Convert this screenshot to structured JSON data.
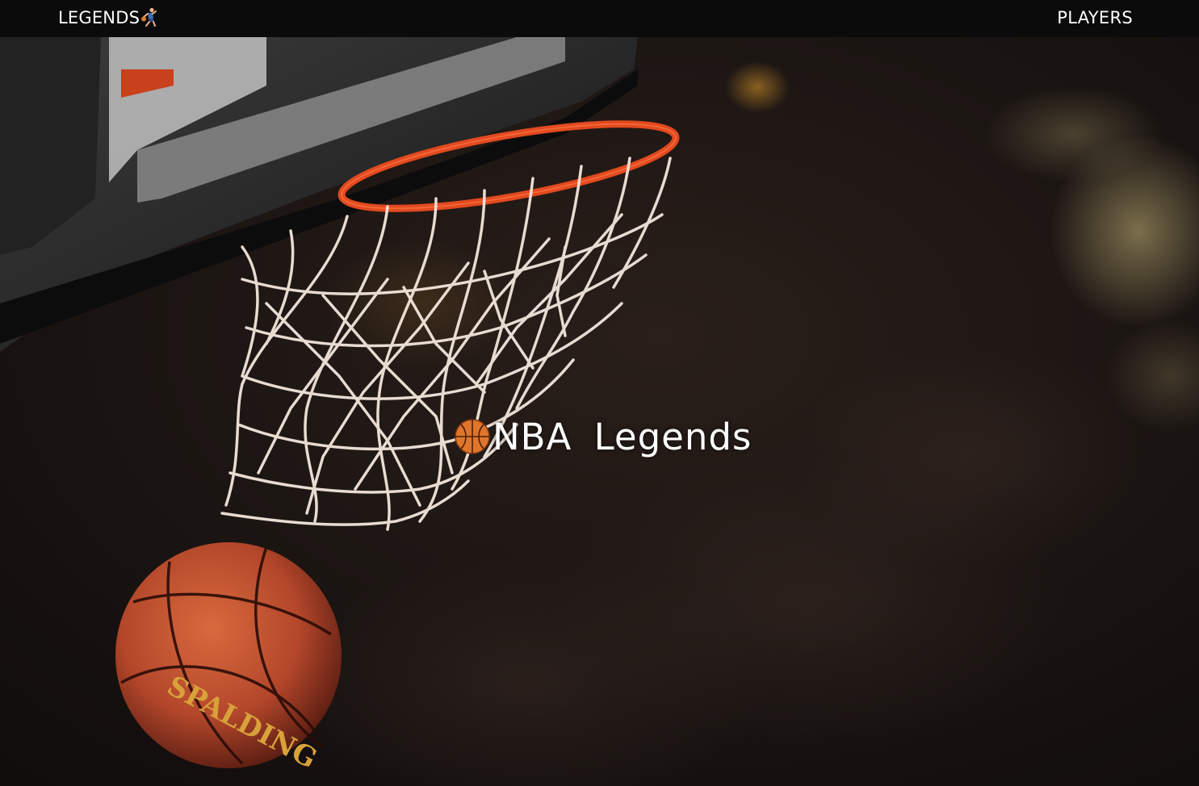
{
  "nav": {
    "logo_label": "LEGENDS",
    "logo_icon": "basketball-player-icon",
    "players_label": "PLAYERS"
  },
  "hero": {
    "title": "NBA Legends",
    "title_icon": "basketball-icon",
    "image": "basketball-hoop-photo"
  },
  "colors": {
    "navbar": "#0b0b0b",
    "text": "#ffffff",
    "rim": "#e2491f",
    "ball": "#c8502a"
  }
}
